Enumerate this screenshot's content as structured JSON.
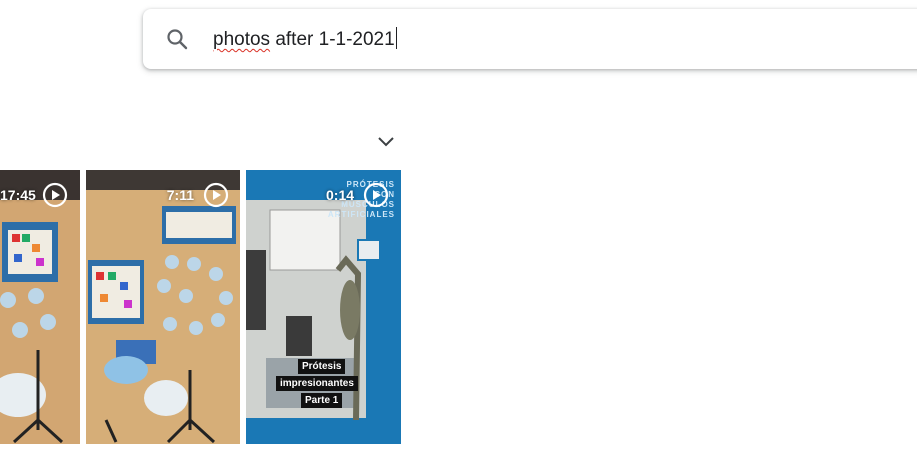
{
  "search": {
    "value": "photos after 1-1-2021",
    "misspelled_word": "photos",
    "rest": " after 1-1-2021",
    "icon": "search-icon"
  },
  "expand": {
    "icon": "chevron-down-icon"
  },
  "thumbnails": [
    {
      "duration": "17:45",
      "icon": "play-circle-icon"
    },
    {
      "duration": "7:11",
      "icon": "play-circle-icon"
    },
    {
      "duration": "0:14",
      "icon": "play-circle-icon",
      "brand_lines": [
        "PRÓTESIS",
        "CON",
        "MÚSCULOS",
        "ARTIFICIALES"
      ],
      "captions": [
        "Prótesis",
        "impresionantes",
        "Parte 1"
      ]
    }
  ]
}
